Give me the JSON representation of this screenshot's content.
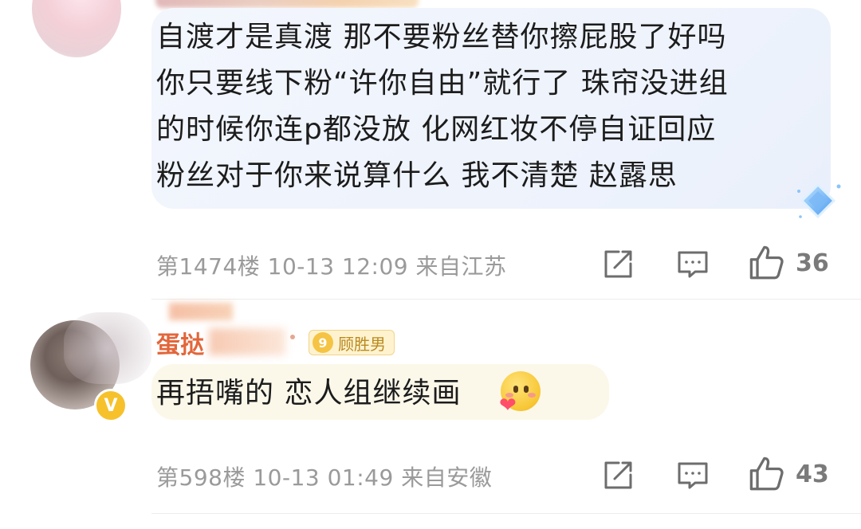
{
  "comments": [
    {
      "text_lines": [
        "自渡才是真渡 那不要粉丝替你擦屁股了好吗",
        "你只要线下粉“许你自由”就行了 珠帘没进组",
        "的时候你连p都没放 化网红妆不停自证回应",
        "粉丝对于你来说算什么 我不清楚 赵露思"
      ],
      "meta": "第1474楼  10-13  12:09  来自江苏",
      "likes": "36"
    },
    {
      "username": "蛋挞",
      "fan_badge": {
        "level": "9",
        "name": "顾胜男"
      },
      "verified_mark": "V",
      "text": "再捂嘴的 恋人组继续画",
      "meta": "第598楼  10-13  01:49  来自安徽",
      "likes": "43"
    }
  ],
  "icons": {
    "share": "share-icon",
    "comment": "comment-icon",
    "like": "thumb-up-icon",
    "badge": "diamond-badge-icon",
    "emoji": "smiley-heart-emoji"
  },
  "colors": {
    "bubble_blue": "#eef3fc",
    "bubble_cream": "#fbf8ea",
    "meta_gray": "#9a9a9a",
    "username_orange": "#e2663a",
    "verified_yellow": "#f6c12b"
  }
}
